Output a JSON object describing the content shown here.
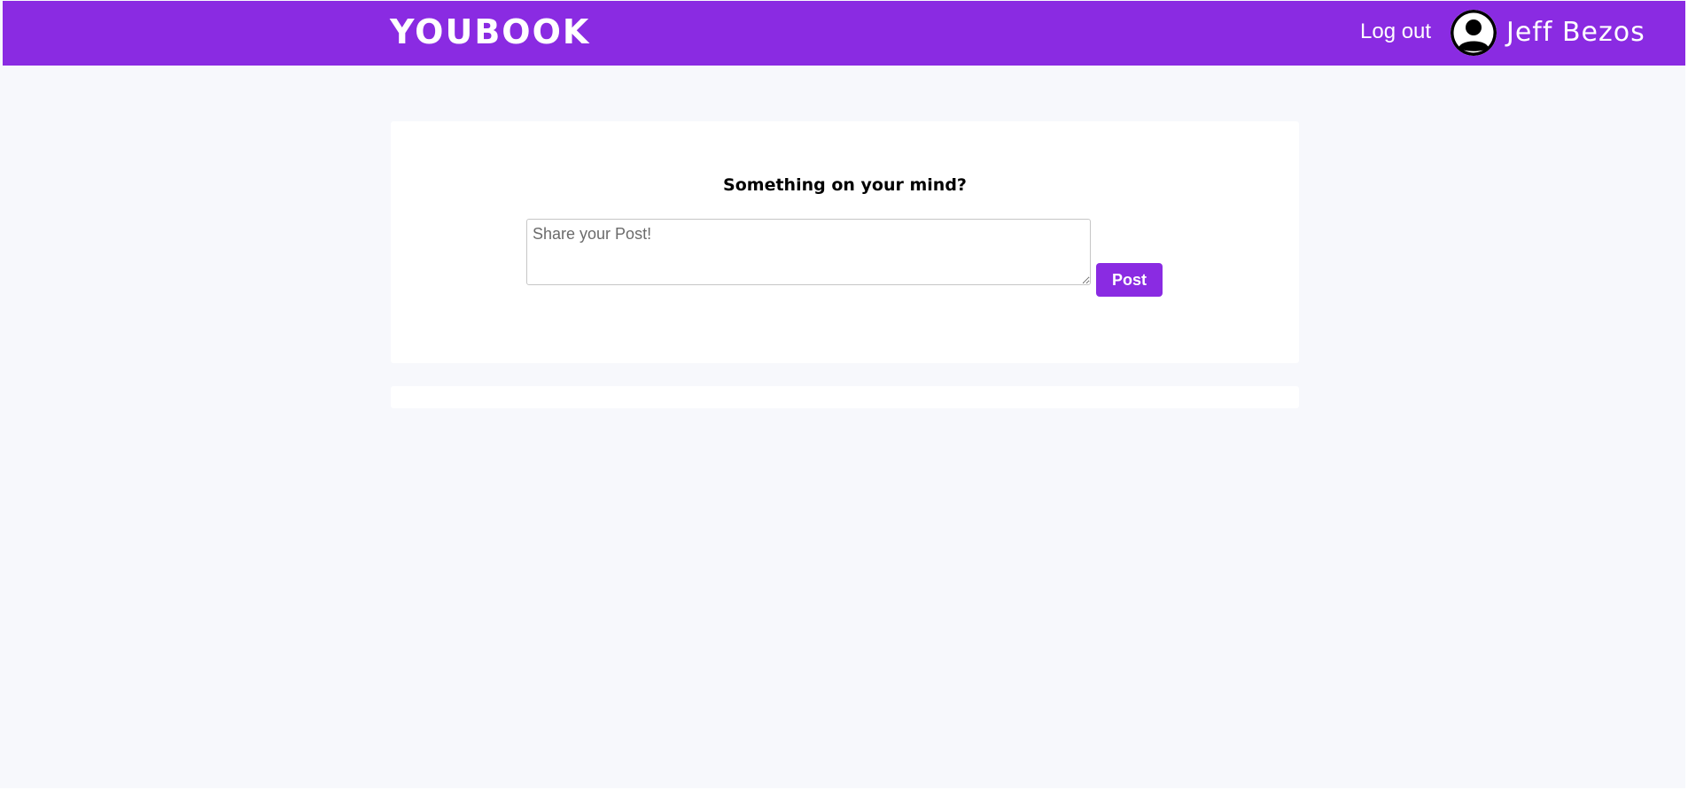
{
  "header": {
    "logo_text": "YOUBOOK",
    "logout_label": "Log out",
    "user_name": "Jeff Bezos",
    "avatar_icon": "user-avatar-icon",
    "background_color": "#8a2be2"
  },
  "composer": {
    "title": "Something on your mind?",
    "textarea_placeholder": "Share your Post!",
    "textarea_value": "",
    "post_button_label": "Post",
    "accent_color": "#8a2be2"
  },
  "feed": {
    "posts": []
  }
}
